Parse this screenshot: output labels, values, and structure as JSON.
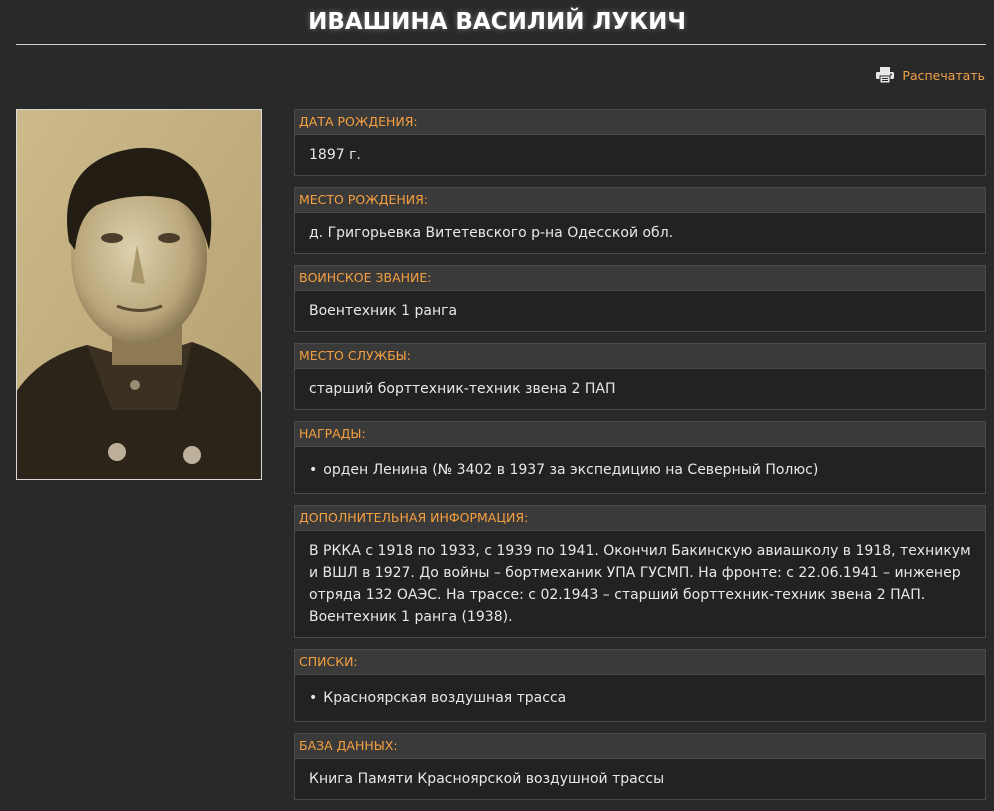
{
  "page": {
    "title": "ИВАШИНА ВАСИЛИЙ ЛУКИЧ",
    "print_label": "Распечатать",
    "accent_color": "#f5a040"
  },
  "fields": {
    "birth_date": {
      "label": "ДАТА РОЖДЕНИЯ:",
      "value": "1897 г."
    },
    "birth_place": {
      "label": "МЕСТО РОЖДЕНИЯ:",
      "value": "д. Григорьевка Витетевского р-на Одесской обл."
    },
    "rank": {
      "label": "ВОИНСКОЕ ЗВАНИЕ:",
      "value": "Воентехник 1 ранга"
    },
    "service_place": {
      "label": "МЕСТО СЛУЖБЫ:",
      "value": "старший борттехник-техник звена 2 ПАП"
    },
    "awards": {
      "label": "НАГРАДЫ:",
      "items": [
        "орден Ленина (№ 3402 в 1937 за экспедицию на Северный Полюс)"
      ]
    },
    "additional": {
      "label": "ДОПОЛНИТЕЛЬНАЯ ИНФОРМАЦИЯ:",
      "value": "В РККА с 1918 по 1933, с 1939 по 1941. Окончил Бакинскую авиашколу в 1918, техникум и ВШЛ в 1927. До войны – бортмеханик УПА ГУСМП. На фронте: с 22.06.1941 – инженер отряда 132 ОАЭС. На трассе: с 02.1943 – старший борттехник-техник звена 2 ПАП. Воентехник 1 ранга (1938)."
    },
    "lists": {
      "label": "СПИСКИ:",
      "items": [
        "Красноярская воздушная трасса"
      ]
    },
    "database": {
      "label": "БАЗА ДАННЫХ:",
      "value": "Книга Памяти Красноярской воздушной трассы"
    }
  }
}
